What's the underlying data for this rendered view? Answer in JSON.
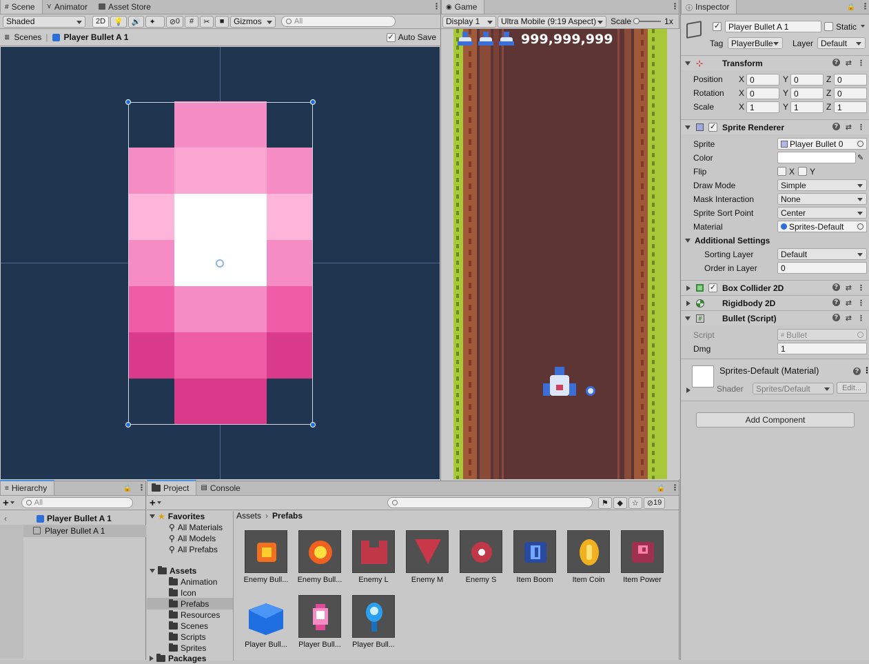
{
  "scene": {
    "tabs": [
      {
        "label": "Scene"
      },
      {
        "label": "Animator"
      },
      {
        "label": "Asset Store"
      }
    ],
    "toolbar": {
      "shading": "Shaded",
      "mode_2d": "2D",
      "hidden_count": "0",
      "gizmos": "Gizmos",
      "search_placeholder": "All"
    },
    "breadcrumb": {
      "root": "Scenes",
      "object": "Player Bullet A 1"
    },
    "auto_save": {
      "label": "Auto Save",
      "checked": true
    }
  },
  "game": {
    "tab": "Game",
    "display": "Display 1",
    "resolution": "Ultra Mobile (9:19 Aspect)",
    "scale_label": "Scale",
    "scale_value": "1x",
    "score": "999,999,999"
  },
  "inspector": {
    "tab": "Inspector",
    "object_name": "Player Bullet A 1",
    "static_label": "Static",
    "tag_label": "Tag",
    "tag_value": "PlayerBulle",
    "layer_label": "Layer",
    "layer_value": "Default",
    "transform": {
      "title": "Transform",
      "position": {
        "label": "Position",
        "x": "0",
        "y": "0",
        "z": "0"
      },
      "rotation": {
        "label": "Rotation",
        "x": "0",
        "y": "0",
        "z": "0"
      },
      "scale": {
        "label": "Scale",
        "x": "1",
        "y": "1",
        "z": "1"
      }
    },
    "sprite_renderer": {
      "title": "Sprite Renderer",
      "sprite_label": "Sprite",
      "sprite_value": "Player Bullet 0",
      "color_label": "Color",
      "flip_label": "Flip",
      "flip_x": "X",
      "flip_y": "Y",
      "draw_mode_label": "Draw Mode",
      "draw_mode_value": "Simple",
      "mask_label": "Mask Interaction",
      "mask_value": "None",
      "sort_point_label": "Sprite Sort Point",
      "sort_point_value": "Center",
      "material_label": "Material",
      "material_value": "Sprites-Default",
      "additional_label": "Additional Settings",
      "sorting_layer_label": "Sorting Layer",
      "sorting_layer_value": "Default",
      "order_label": "Order in Layer",
      "order_value": "0"
    },
    "box_collider": {
      "title": "Box Collider 2D"
    },
    "rigidbody": {
      "title": "Rigidbody 2D"
    },
    "bullet_script": {
      "title": "Bullet (Script)",
      "script_label": "Script",
      "script_value": "Bullet",
      "dmg_label": "Dmg",
      "dmg_value": "1"
    },
    "material": {
      "title": "Sprites-Default (Material)",
      "shader_label": "Shader",
      "shader_value": "Sprites/Default",
      "edit_label": "Edit..."
    },
    "add_component": "Add Component"
  },
  "hierarchy": {
    "tab": "Hierarchy",
    "search_placeholder": "All",
    "root": "Player Bullet A 1",
    "child": "Player Bullet A 1"
  },
  "project": {
    "tabs": [
      {
        "label": "Project"
      },
      {
        "label": "Console"
      }
    ],
    "hidden_count": "19",
    "favorites": {
      "label": "Favorites",
      "items": [
        "All Materials",
        "All Models",
        "All Prefabs"
      ]
    },
    "assets_label": "Assets",
    "folders": [
      "Animation",
      "Icon",
      "Prefabs",
      "Resources",
      "Scenes",
      "Scripts",
      "Sprites"
    ],
    "packages_label": "Packages",
    "breadcrumb": {
      "root": "Assets",
      "current": "Prefabs"
    },
    "items": [
      {
        "name": "Enemy Bull..."
      },
      {
        "name": "Enemy Bull..."
      },
      {
        "name": "Enemy L"
      },
      {
        "name": "Enemy M"
      },
      {
        "name": "Enemy S"
      },
      {
        "name": "Item Boom"
      },
      {
        "name": "Item Coin"
      },
      {
        "name": "Item Power"
      },
      {
        "name": "Player Bull..."
      },
      {
        "name": "Player Bull..."
      },
      {
        "name": "Player Bull..."
      }
    ]
  },
  "colors": {
    "accent": "#4a90e2",
    "scene_bg": "#203550",
    "game_road": "#5e3535",
    "bullet_pink": "#f07ab8"
  }
}
